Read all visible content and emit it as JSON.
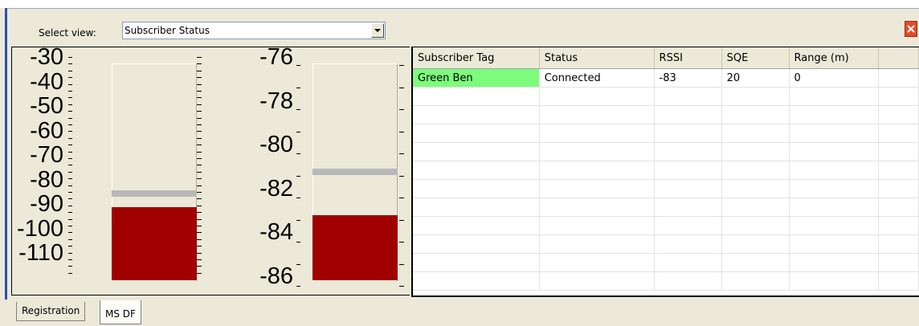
{
  "header": {
    "select_label": "Select view:",
    "selected_view": "Subscriber Status",
    "close_icon": "close-icon"
  },
  "left_gauge": {
    "labels": [
      "-30",
      "-40",
      "-50",
      "-60",
      "-70",
      "-80",
      "-90",
      "-100",
      "-110"
    ],
    "min": -110,
    "max": -30,
    "level": -83,
    "reference": -78,
    "fill_color": "#a00000",
    "reference_color": "#b8b8b8"
  },
  "right_gauge": {
    "labels": [
      "-76",
      "-78",
      "-80",
      "-82",
      "-84",
      "-86"
    ],
    "min": -86,
    "max": -76,
    "level": -83,
    "reference": -81,
    "fill_color": "#a00000",
    "reference_color": "#b8b8b8"
  },
  "table": {
    "columns": [
      "Subscriber Tag",
      "Status",
      "RSSI",
      "SQE",
      "Range (m)"
    ],
    "rows": [
      {
        "tag": "Green Ben",
        "status": "Connected",
        "rssi": "-83",
        "sqe": "20",
        "range": "0",
        "tag_color": "#7cfc7c"
      }
    ],
    "empty_rows": 11
  },
  "tabs": [
    "Registration",
    "MS DF"
  ],
  "active_tab": "MS DF"
}
